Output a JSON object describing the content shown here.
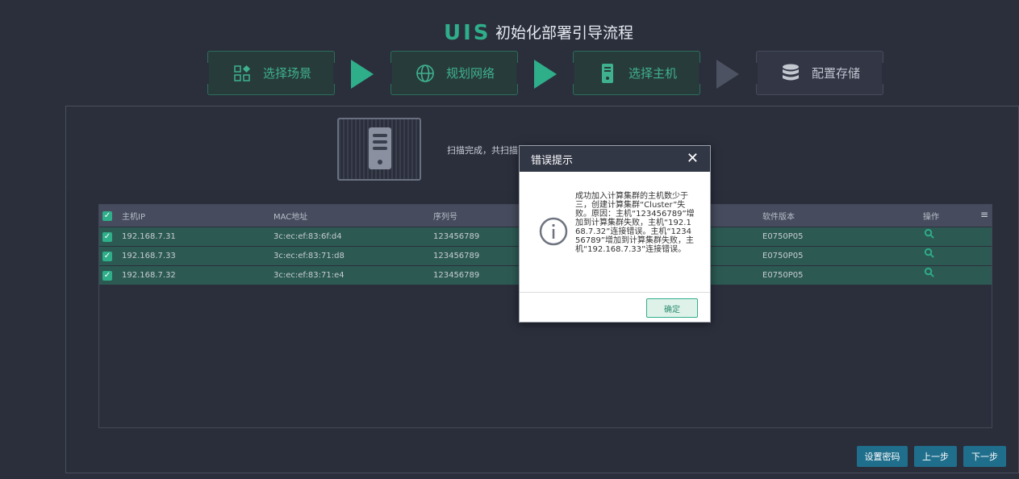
{
  "header": {
    "logo": "UIS",
    "title": "初始化部署引导流程"
  },
  "steps": [
    {
      "label": "选择场景",
      "icon": "grid-shapes-icon",
      "state": "done"
    },
    {
      "label": "规划网络",
      "icon": "globe-icon",
      "state": "done"
    },
    {
      "label": "选择主机",
      "icon": "server-icon",
      "state": "active"
    },
    {
      "label": "配置存储",
      "icon": "database-icon",
      "state": "pending"
    }
  ],
  "scan": {
    "status_text": "扫描完成，共扫描"
  },
  "table": {
    "headers": [
      "主机IP",
      "MAC地址",
      "序列号",
      "软件版本",
      "操作"
    ],
    "rows": [
      {
        "ip": "192.168.7.31",
        "mac": "3c:ec:ef:83:6f:d4",
        "serial": "123456789",
        "version": "E0750P05"
      },
      {
        "ip": "192.168.7.33",
        "mac": "3c:ec:ef:83:71:d8",
        "serial": "123456789",
        "version": "E0750P05"
      },
      {
        "ip": "192.168.7.32",
        "mac": "3c:ec:ef:83:71:e4",
        "serial": "123456789",
        "version": "E0750P05"
      }
    ]
  },
  "buttons": {
    "set_password": "设置密码",
    "prev": "上一步",
    "next": "下一步"
  },
  "dialog": {
    "title": "错误提示",
    "message": "成功加入计算集群的主机数少于三，创建计算集群“Cluster”失败。原因：主机“123456789”增加到计算集群失败，主机“192.168.7.32”连接错误。主机“123456789”增加到计算集群失败，主机“192.168.7.33”连接错误。",
    "ok": "确定"
  },
  "colors": {
    "accent": "#2fae8a",
    "button": "#1f6e8c",
    "row_selected": "#2c5a52"
  }
}
